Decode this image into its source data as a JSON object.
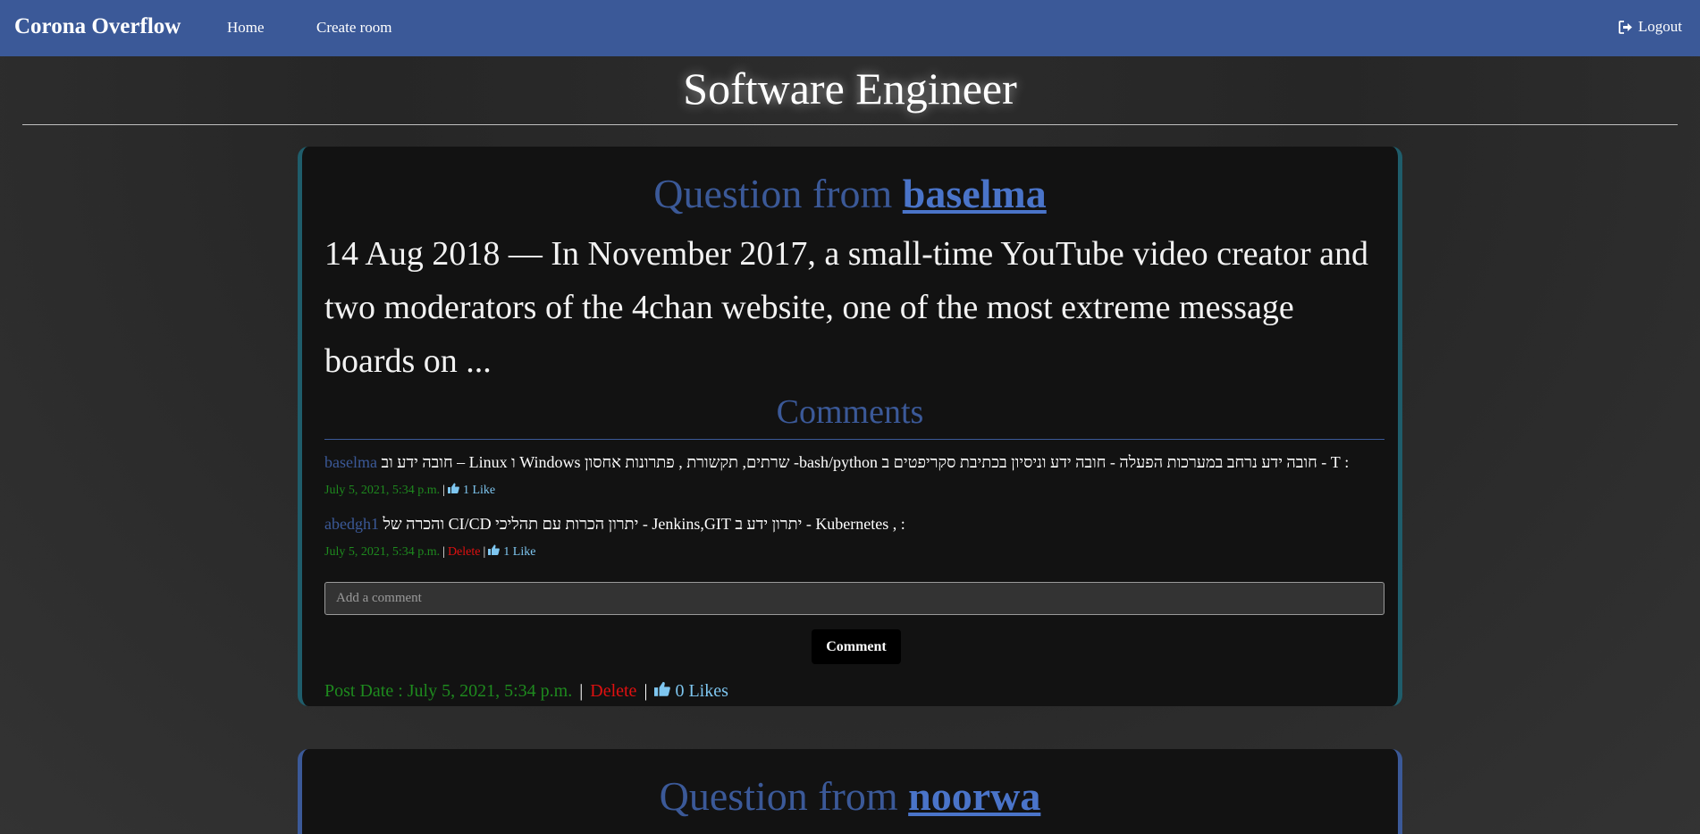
{
  "navbar": {
    "brand": "Corona Overflow",
    "links": [
      "Home",
      "Create room"
    ],
    "logout_label": "Logout",
    "logout_icon": "sign-out-icon"
  },
  "page": {
    "title": "Software Engineer"
  },
  "posts": [
    {
      "header_prefix": "Question from",
      "author": "baselma",
      "body": "14 Aug 2018 — In November 2017, a small-time YouTube video creator and two moderators of the 4chan website, one of the most extreme message boards on ...",
      "comments_heading": "Comments",
      "comments": [
        {
          "author": "baselma",
          "text": ": T - חובה ידע נרחב במערכות הפעלה - חובה ידע וניסיון בכתיבת סקריפטים ב bash/python- שרתים, תקשורת , פתרונות אחסון Windows ו Linux – חובה ידע וב",
          "date": "July 5, 2021, 5:34 p.m.",
          "delete_label": "",
          "likes": "1 Like"
        },
        {
          "author": "abedgh1",
          "text": ": , Kubernetes - יתרון ידע ב Jenkins,GIT - יתרון הכרות עם תהליכי CI/CD והכרה של",
          "date": "July 5, 2021, 5:34 p.m.",
          "delete_label": "Delete",
          "likes": "1 Like"
        }
      ],
      "comment_placeholder": "Add a comment",
      "comment_button": "Comment",
      "post_date": "Post Date : July 5, 2021, 5:34 p.m.",
      "delete_label": "Delete",
      "likes": "0 Likes"
    },
    {
      "header_prefix": "Question from",
      "author": "noorwa"
    }
  ],
  "colors": {
    "navbar": "#3b5998",
    "accent_link": "#4a74c9",
    "date_green": "#1e8a1e",
    "delete_red": "#e01010",
    "like_blue": "#7ec6f0"
  }
}
